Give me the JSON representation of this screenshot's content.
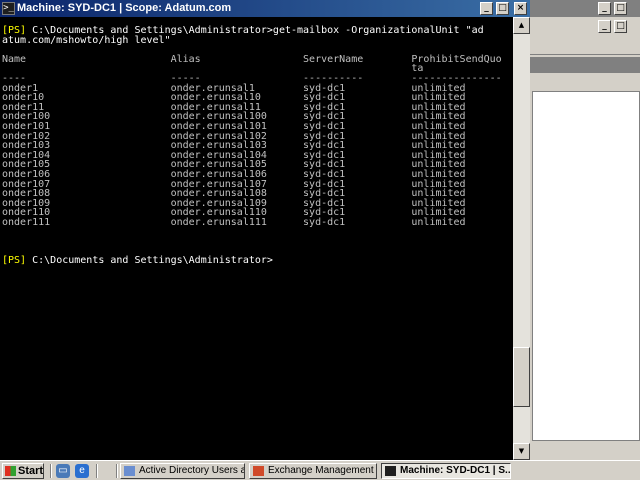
{
  "window": {
    "title": "Machine: SYD-DC1 | Scope: Adatum.com",
    "icon_glyph": ">_",
    "min_glyph": "_",
    "max_glyph": "□",
    "close_glyph": "×"
  },
  "console": {
    "prompt_tag": "[PS]",
    "command_line_1": " C:\\Documents and Settings\\Administrator>get-mailbox -OrganizationalUnit \"ad",
    "command_line_2": "atum.com/mshowto/high level\"",
    "columns": [
      "Name",
      "Alias",
      "ServerName",
      "ProhibitSendQuo"
    ],
    "column_wrap": "ta",
    "underline": "----                           -----                     ----------          ---------------",
    "rows": [
      {
        "name": "onder1",
        "alias": "onder.erunsal1",
        "server": "syd-dc1",
        "quota": "unlimited"
      },
      {
        "name": "onder10",
        "alias": "onder.erunsal10",
        "server": "syd-dc1",
        "quota": "unlimited"
      },
      {
        "name": "onder11",
        "alias": "onder.erunsal11",
        "server": "syd-dc1",
        "quota": "unlimited"
      },
      {
        "name": "onder100",
        "alias": "onder.erunsal100",
        "server": "syd-dc1",
        "quota": "unlimited"
      },
      {
        "name": "onder101",
        "alias": "onder.erunsal101",
        "server": "syd-dc1",
        "quota": "unlimited"
      },
      {
        "name": "onder102",
        "alias": "onder.erunsal102",
        "server": "syd-dc1",
        "quota": "unlimited"
      },
      {
        "name": "onder103",
        "alias": "onder.erunsal103",
        "server": "syd-dc1",
        "quota": "unlimited"
      },
      {
        "name": "onder104",
        "alias": "onder.erunsal104",
        "server": "syd-dc1",
        "quota": "unlimited"
      },
      {
        "name": "onder105",
        "alias": "onder.erunsal105",
        "server": "syd-dc1",
        "quota": "unlimited"
      },
      {
        "name": "onder106",
        "alias": "onder.erunsal106",
        "server": "syd-dc1",
        "quota": "unlimited"
      },
      {
        "name": "onder107",
        "alias": "onder.erunsal107",
        "server": "syd-dc1",
        "quota": "unlimited"
      },
      {
        "name": "onder108",
        "alias": "onder.erunsal108",
        "server": "syd-dc1",
        "quota": "unlimited"
      },
      {
        "name": "onder109",
        "alias": "onder.erunsal109",
        "server": "syd-dc1",
        "quota": "unlimited"
      },
      {
        "name": "onder110",
        "alias": "onder.erunsal110",
        "server": "syd-dc1",
        "quota": "unlimited"
      },
      {
        "name": "onder111",
        "alias": "onder.erunsal111",
        "server": "syd-dc1",
        "quota": "unlimited"
      }
    ],
    "final_prompt": " C:\\Documents and Settings\\Administrator>"
  },
  "scrollbar": {
    "up_glyph": "▲",
    "down_glyph": "▼"
  },
  "taskbar": {
    "start_label": "Start",
    "tasks": [
      {
        "label": "Active Directory Users a...",
        "active": false
      },
      {
        "label": "Exchange Management ...",
        "active": false
      },
      {
        "label": "Machine: SYD-DC1 | S...",
        "active": true
      }
    ],
    "quicklaunch_icons": [
      "desktop-icon",
      "ie-icon"
    ]
  },
  "colors": {
    "prompt": "#ffff00",
    "console_bg": "#000000",
    "console_text": "#c0c0c0",
    "title_gradient_start": "#0a246a",
    "title_gradient_end": "#3a6ea5"
  }
}
